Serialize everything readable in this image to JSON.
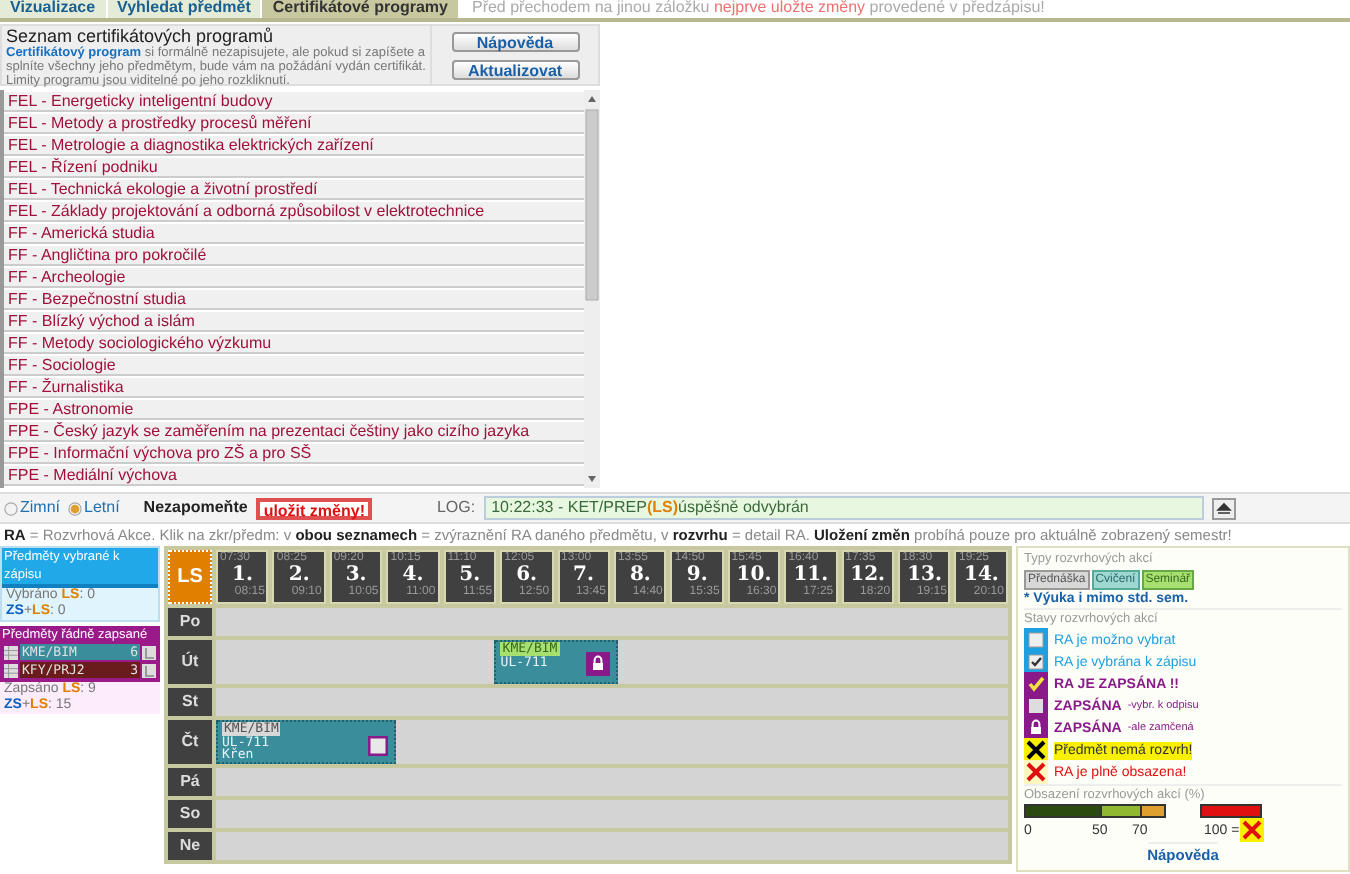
{
  "tabs": [
    {
      "label": "Vizualizace",
      "selected": false
    },
    {
      "label": "Vyhledat předmět",
      "selected": false
    },
    {
      "label": "Certifikátové programy",
      "selected": true
    }
  ],
  "notice": [
    {
      "text": "Před přechodem na jinou záložku ",
      "kind": "plain"
    },
    {
      "text": "nejprve uložte změny",
      "kind": "alert"
    },
    {
      "text": " provedené v předzápisu!",
      "kind": "plain"
    }
  ],
  "info_panel": {
    "title": "Seznam certifikátových programů",
    "description": "**Certifikátový program** si formálně nezapisujete, ale pokud si zapíšete a splníte všechny jeho předmětym, bude vám na požádání vydán certifikát. Limity programu jsou viditelné po jeho rozkliknutí.",
    "buttons": [
      "Nápověda",
      "Aktualizovat"
    ]
  },
  "programs": [
    "FEL - Energeticky inteligentní budovy",
    "FEL - Metody a prostředky procesů měření",
    "FEL - Metrologie a diagnostika elektrických zařízení",
    "FEL - Řízení podniku",
    "FEL - Technická ekologie a životní prostředí",
    "FEL - Základy projektování a odborná způsobilost v elektrotechnice",
    "FF - Americká studia",
    "FF - Angličtina pro pokročilé",
    "FF - Archeologie",
    "FF - Bezpečnostní studia",
    "FF - Blízký východ a islám",
    "FF - Metody sociologického výzkumu",
    "FF - Sociologie",
    "FF - Žurnalistika",
    "FPE - Astronomie",
    "FPE - Český jazyk se zaměřením na prezentaci češtiny jako cizího jazyka",
    "FPE - Informační výchova pro ZŠ a pro SŠ",
    "FPE - Mediální výchova"
  ],
  "semester_bar": {
    "semesters": [
      {
        "label": "Zimní",
        "selected": false
      },
      {
        "label": "Letní",
        "selected": true
      }
    ],
    "reminder": "Nezapomeňte",
    "save_button": "uložit změny!",
    "log_label": "LOG:",
    "log": [
      {
        "text": "10:22:33 - KET/PREP ",
        "kind": "plain"
      },
      {
        "text": "(LS)",
        "kind": "ls"
      },
      {
        "text": " úspěšně odvybrán",
        "kind": "plain"
      }
    ]
  },
  "hint": "**RA** = Rozvrhová Akce. Klik na zkr/předm: v **obou seznamech** = zvýraznění RA daného předmětu, v **rozvrhu** = detail RA. **Uložení změn** probíhá pouze pro aktuálně zobrazený semestr!",
  "selected_panel": {
    "title": "Předměty vybrané k zápisu",
    "lines": [
      [
        {
          "text": "Vybráno ",
          "kind": "plain"
        },
        {
          "text": "LS",
          "kind": "ls"
        },
        {
          "text": ": 0",
          "kind": "plain"
        }
      ],
      [
        {
          "text": "ZS",
          "kind": "zs"
        },
        {
          "text": "+",
          "kind": "plain"
        },
        {
          "text": "LS",
          "kind": "ls"
        },
        {
          "text": ": 0",
          "kind": "plain"
        }
      ]
    ]
  },
  "enrolled_panel": {
    "title": "Předměty řádně zapsané",
    "courses": [
      {
        "code": "KME/BIM",
        "credits": "6",
        "color": "#3a8e9c"
      },
      {
        "code": "KFY/PRJ2",
        "credits": "3",
        "color": "#6a1c1c"
      }
    ],
    "lines": [
      [
        {
          "text": "Zapsáno ",
          "kind": "plain"
        },
        {
          "text": "LS",
          "kind": "ls"
        },
        {
          "text": ": 9",
          "kind": "plain"
        }
      ],
      [
        {
          "text": "ZS",
          "kind": "zs"
        },
        {
          "text": "+",
          "kind": "plain"
        },
        {
          "text": "LS",
          "kind": "ls"
        },
        {
          "text": ": 15",
          "kind": "plain"
        }
      ]
    ]
  },
  "schedule": {
    "semester": "LS",
    "slots": [
      {
        "number": "1.",
        "start": "07:30",
        "end": "08:15"
      },
      {
        "number": "2.",
        "start": "08:25",
        "end": "09:10"
      },
      {
        "number": "3.",
        "start": "09:20",
        "end": "10:05"
      },
      {
        "number": "4.",
        "start": "10:15",
        "end": "11:00"
      },
      {
        "number": "5.",
        "start": "11:10",
        "end": "11:55"
      },
      {
        "number": "6.",
        "start": "12:05",
        "end": "12:50"
      },
      {
        "number": "7.",
        "start": "13:00",
        "end": "13:45"
      },
      {
        "number": "8.",
        "start": "13:55",
        "end": "14:40"
      },
      {
        "number": "9.",
        "start": "14:50",
        "end": "15:35"
      },
      {
        "number": "10.",
        "start": "15:45",
        "end": "16:30"
      },
      {
        "number": "11.",
        "start": "16:40",
        "end": "17:25"
      },
      {
        "number": "12.",
        "start": "17:35",
        "end": "18:20"
      },
      {
        "number": "13.",
        "start": "18:30",
        "end": "19:15"
      },
      {
        "number": "14.",
        "start": "19:25",
        "end": "20:10"
      }
    ],
    "days": [
      {
        "label": "Po"
      },
      {
        "label": "Út",
        "cells": [
          {
            "kind": "free"
          },
          {
            "kind": "free"
          },
          {
            "kind": "free"
          },
          {
            "kind": "free"
          },
          {
            "kind": "free"
          },
          {
            "kind": "seminar",
            "code": "KME/BIM",
            "room": "UL-711",
            "locked": true
          },
          {
            "kind": "continued"
          },
          {
            "kind": "free"
          },
          {
            "kind": "free"
          },
          {
            "kind": "free"
          },
          {
            "kind": "free"
          },
          {
            "kind": "free"
          },
          {
            "kind": "free"
          },
          {
            "kind": "free"
          }
        ]
      },
      {
        "label": "St"
      },
      {
        "label": "Čt",
        "cells": [
          {
            "kind": "lecture",
            "code": "KME/BIM",
            "room": "UL-711",
            "teacher": "Křen",
            "locked": false
          },
          {
            "kind": "continued"
          },
          {
            "kind": "continued"
          },
          {
            "kind": "free"
          },
          {
            "kind": "free"
          },
          {
            "kind": "free"
          },
          {
            "kind": "free"
          },
          {
            "kind": "free"
          },
          {
            "kind": "free"
          },
          {
            "kind": "free"
          },
          {
            "kind": "free"
          },
          {
            "kind": "free"
          },
          {
            "kind": "free"
          },
          {
            "kind": "free"
          }
        ]
      },
      {
        "label": "Pá"
      },
      {
        "label": "So"
      },
      {
        "label": "Ne"
      }
    ]
  },
  "legend": {
    "types_title": "Typy rozvrhových akcí",
    "types": [
      {
        "label": "Přednáška",
        "kind": "lecture"
      },
      {
        "label": "Cvičení",
        "kind": "exercise"
      },
      {
        "label": "Seminář",
        "kind": "seminar"
      }
    ],
    "note": "* Výuka i mimo std. sem.",
    "states_title": "Stavy rozvrhových akcí",
    "states": [
      {
        "kind": "selectable",
        "text": "RA je možno vybrat"
      },
      {
        "kind": "selected",
        "text": "RA je vybrána k zápisu"
      },
      {
        "kind": "enrolled",
        "text": "RA JE ZAPSÁNA !!"
      },
      {
        "kind": "deselect",
        "text": "ZAPSÁNA",
        "note": "-vybr. k odpisu"
      },
      {
        "kind": "locked",
        "text": "ZAPSÁNA",
        "note": "-ale zamčená"
      },
      {
        "kind": "no_schedule",
        "text": "Předmět nemá rozvrh!"
      },
      {
        "kind": "full",
        "text": "RA je plně obsazena!"
      }
    ],
    "occupancy_title": "Obsazení rozvrhových akcí (%)",
    "occupancy_ticks": [
      "0",
      "50",
      "70",
      "100 ="
    ],
    "help": "Nápověda"
  }
}
